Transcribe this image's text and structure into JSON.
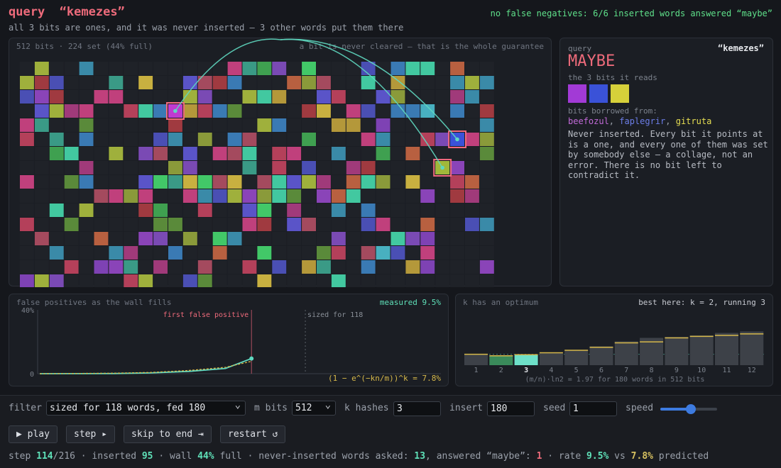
{
  "header": {
    "query_label": "query",
    "query_word": "“kemezes”",
    "subtitle": "all 3 bits are ones, and it was never inserted — 3 other words put them there",
    "right_note": "no false negatives: 6/6 inserted words answered “maybe”"
  },
  "bitgrid": {
    "caption_left": "512 bits · 224 set (44% full)",
    "caption_right": "a bit is never cleared — that is the whole guarantee",
    "cols": 32,
    "rows": 16
  },
  "query_panel": {
    "label": "query",
    "word": "“kemezes”",
    "verdict": "MAYBE",
    "reads_label": "the 3 bits it reads",
    "read_bit_colors": [
      "#a23ad6",
      "#3a52d8",
      "#d6d03a"
    ],
    "borrowed_label": "bits borrowed from:",
    "borrowed": [
      {
        "word": "beefozul",
        "color": "#c26ad8"
      },
      {
        "word": "faplegrir",
        "color": "#6c7ee8"
      },
      {
        "word": "gitruta",
        "color": "#e6de52"
      }
    ],
    "description": "Never inserted. Every bit it points at is a one, and every one of them was set by somebody else — a collage, not an error. There is no bit left to contradict it."
  },
  "fp_chart": {
    "caption": "false positives as the wall fills",
    "measured": "measured 9.5%",
    "annotation_first": "first false positive",
    "annotation_sized": "sized for 118",
    "formula": "(1 − e^(−kn/m))^k = 7.8%"
  },
  "k_chart": {
    "caption": "k has an optimum",
    "best": "best here: k = 2, running 3",
    "footer": "(m/n)·ln2 = 1.97 for 180 words in 512 bits"
  },
  "chart_data": [
    {
      "type": "line",
      "title": "false positives as the wall fills",
      "xlim": [
        0,
        216
      ],
      "ylim": [
        0,
        40
      ],
      "y_ticks": [
        "0",
        "40%"
      ],
      "series": [
        {
          "name": "measured",
          "color": "#5fd8c0",
          "x": [
            0,
            40,
            60,
            80,
            100,
            114
          ],
          "y": [
            0,
            0.1,
            0.5,
            1.4,
            3.3,
            9.5
          ]
        },
        {
          "name": "predicted",
          "color": "#d6b84a",
          "x": [
            0,
            40,
            60,
            80,
            100,
            114
          ],
          "y": [
            0,
            0.3,
            0.8,
            2.0,
            4.0,
            7.8
          ]
        }
      ],
      "markers": {
        "first_false_positive_step": 114,
        "sized_for_step": 143
      }
    },
    {
      "type": "bar",
      "title": "k has an optimum",
      "categories": [
        "1",
        "2",
        "3",
        "4",
        "5",
        "6",
        "7",
        "8",
        "9",
        "10",
        "11",
        "12"
      ],
      "values": [
        22,
        19,
        21,
        25,
        30,
        38,
        48,
        55,
        57,
        60,
        65,
        68
      ],
      "predicted": [
        22,
        19,
        21,
        25,
        30,
        36,
        45,
        47,
        55,
        58,
        60,
        63
      ],
      "optimum_k": 2,
      "running_k": 3,
      "ylim": [
        0,
        100
      ],
      "reference_line": 22
    }
  ],
  "controls": {
    "filter_label": "filter",
    "filter_value": "sized for 118 words, fed 180",
    "mbits_label": "m bits",
    "mbits_value": "512",
    "khashes_label": "k hashes",
    "khashes_value": "3",
    "insert_label": "insert",
    "insert_value": "180",
    "seed_label": "seed",
    "seed_value": "1",
    "speed_label": "speed",
    "speed_level": 0.55,
    "play": "▶ play",
    "step": "step ▸",
    "skip": "skip to end ⇥",
    "restart": "restart ↺"
  },
  "status": {
    "step_label": "step ",
    "step": "114",
    "total": "/216 · inserted ",
    "inserted": "95",
    "wall_label": " · wall ",
    "wall": "44%",
    "full_label": " full · never-inserted words asked: ",
    "asked": "13",
    "answered_label": ", answered “maybe”: ",
    "answered": "1",
    "rate_label": " · rate ",
    "rate": "9.5%",
    "vs_label": " vs ",
    "predicted": "7.8%",
    "predicted_label": " predicted"
  }
}
